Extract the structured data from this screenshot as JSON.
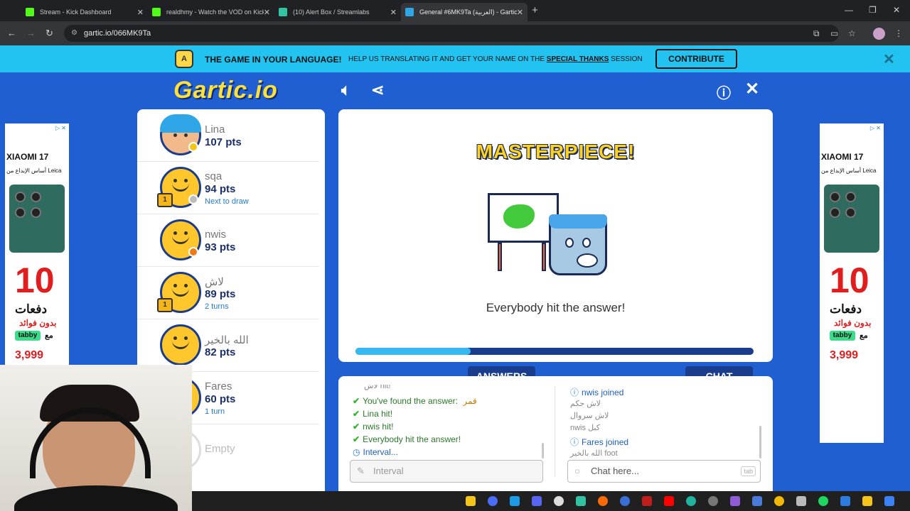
{
  "browser": {
    "tabs": [
      {
        "title": "Stream - Kick Dashboard",
        "icon": "kick-icon",
        "color": "#53fc18"
      },
      {
        "title": "realdhmy - Watch the VOD on Kick",
        "icon": "kick-icon",
        "color": "#53fc18"
      },
      {
        "title": "(10) Alert Box / Streamlabs",
        "icon": "streamlabs-icon",
        "color": "#31c3a2"
      },
      {
        "title": "General #6MK9Ta (العربية) - Gartic.io",
        "icon": "gartic-icon",
        "color": "#2fa6e8"
      }
    ],
    "url": "gartic.io/066MK9Ta"
  },
  "banner": {
    "icon_text": "A",
    "headline": "THE GAME IN YOUR LANGUAGE!",
    "sub_prefix": "HELP US TRANSLATING IT AND GET YOUR NAME ON THE",
    "sub_link": "SPECIAL THANKS",
    "sub_suffix": "SESSION",
    "button": "CONTRIBUTE"
  },
  "game": {
    "logo": "Gartic.io",
    "players": [
      {
        "name": "Lina",
        "points": "107 pts",
        "note": ""
      },
      {
        "name": "sqa",
        "points": "94 pts",
        "note": "Next to draw"
      },
      {
        "name": "nwis",
        "points": "93 pts",
        "note": ""
      },
      {
        "name": "لاش",
        "points": "89 pts",
        "note": "2 turns"
      },
      {
        "name": "الله بالخير",
        "points": "82 pts",
        "note": ""
      },
      {
        "name": "Fares",
        "points": "60 pts",
        "note": "1 turn"
      },
      {
        "name": "Empty",
        "points": "",
        "note": ""
      }
    ],
    "trophy_label": "1",
    "canvas": {
      "title": "MASTERPIECE!",
      "message": "Everybody hit the answer!",
      "progress": 0.29
    },
    "answers": {
      "tab": "ANSWERS",
      "messages": [
        "You've found the answer:",
        "Lina hit!",
        "nwis hit!",
        "Everybody hit the answer!",
        "Interval..."
      ],
      "found_word": "قمر",
      "partial_top": "لاش hit!",
      "placeholder": "Interval"
    },
    "chat": {
      "tab": "CHAT",
      "messages": [
        "nwis joined",
        "لاش حكم",
        "لاش سروال",
        "nwis كبل",
        "Fares joined",
        "الله بالخير foot"
      ],
      "placeholder": "Chat here...",
      "tab_key": "tab"
    }
  },
  "ad": {
    "brand": "XIAOMI 17",
    "tagline": "أساس الإبداع من Leica",
    "big_number": "10",
    "line1": "دفعات",
    "line2": "بدون فوائد",
    "tabby": "tabby",
    "with": "مع",
    "price": "3,999",
    "badge": "▷ ✕"
  },
  "colors": {
    "banner": "#22c3f0",
    "game_bg": "#1f5fd2",
    "navy": "#1a3c8c",
    "gold": "#ffd21f"
  }
}
